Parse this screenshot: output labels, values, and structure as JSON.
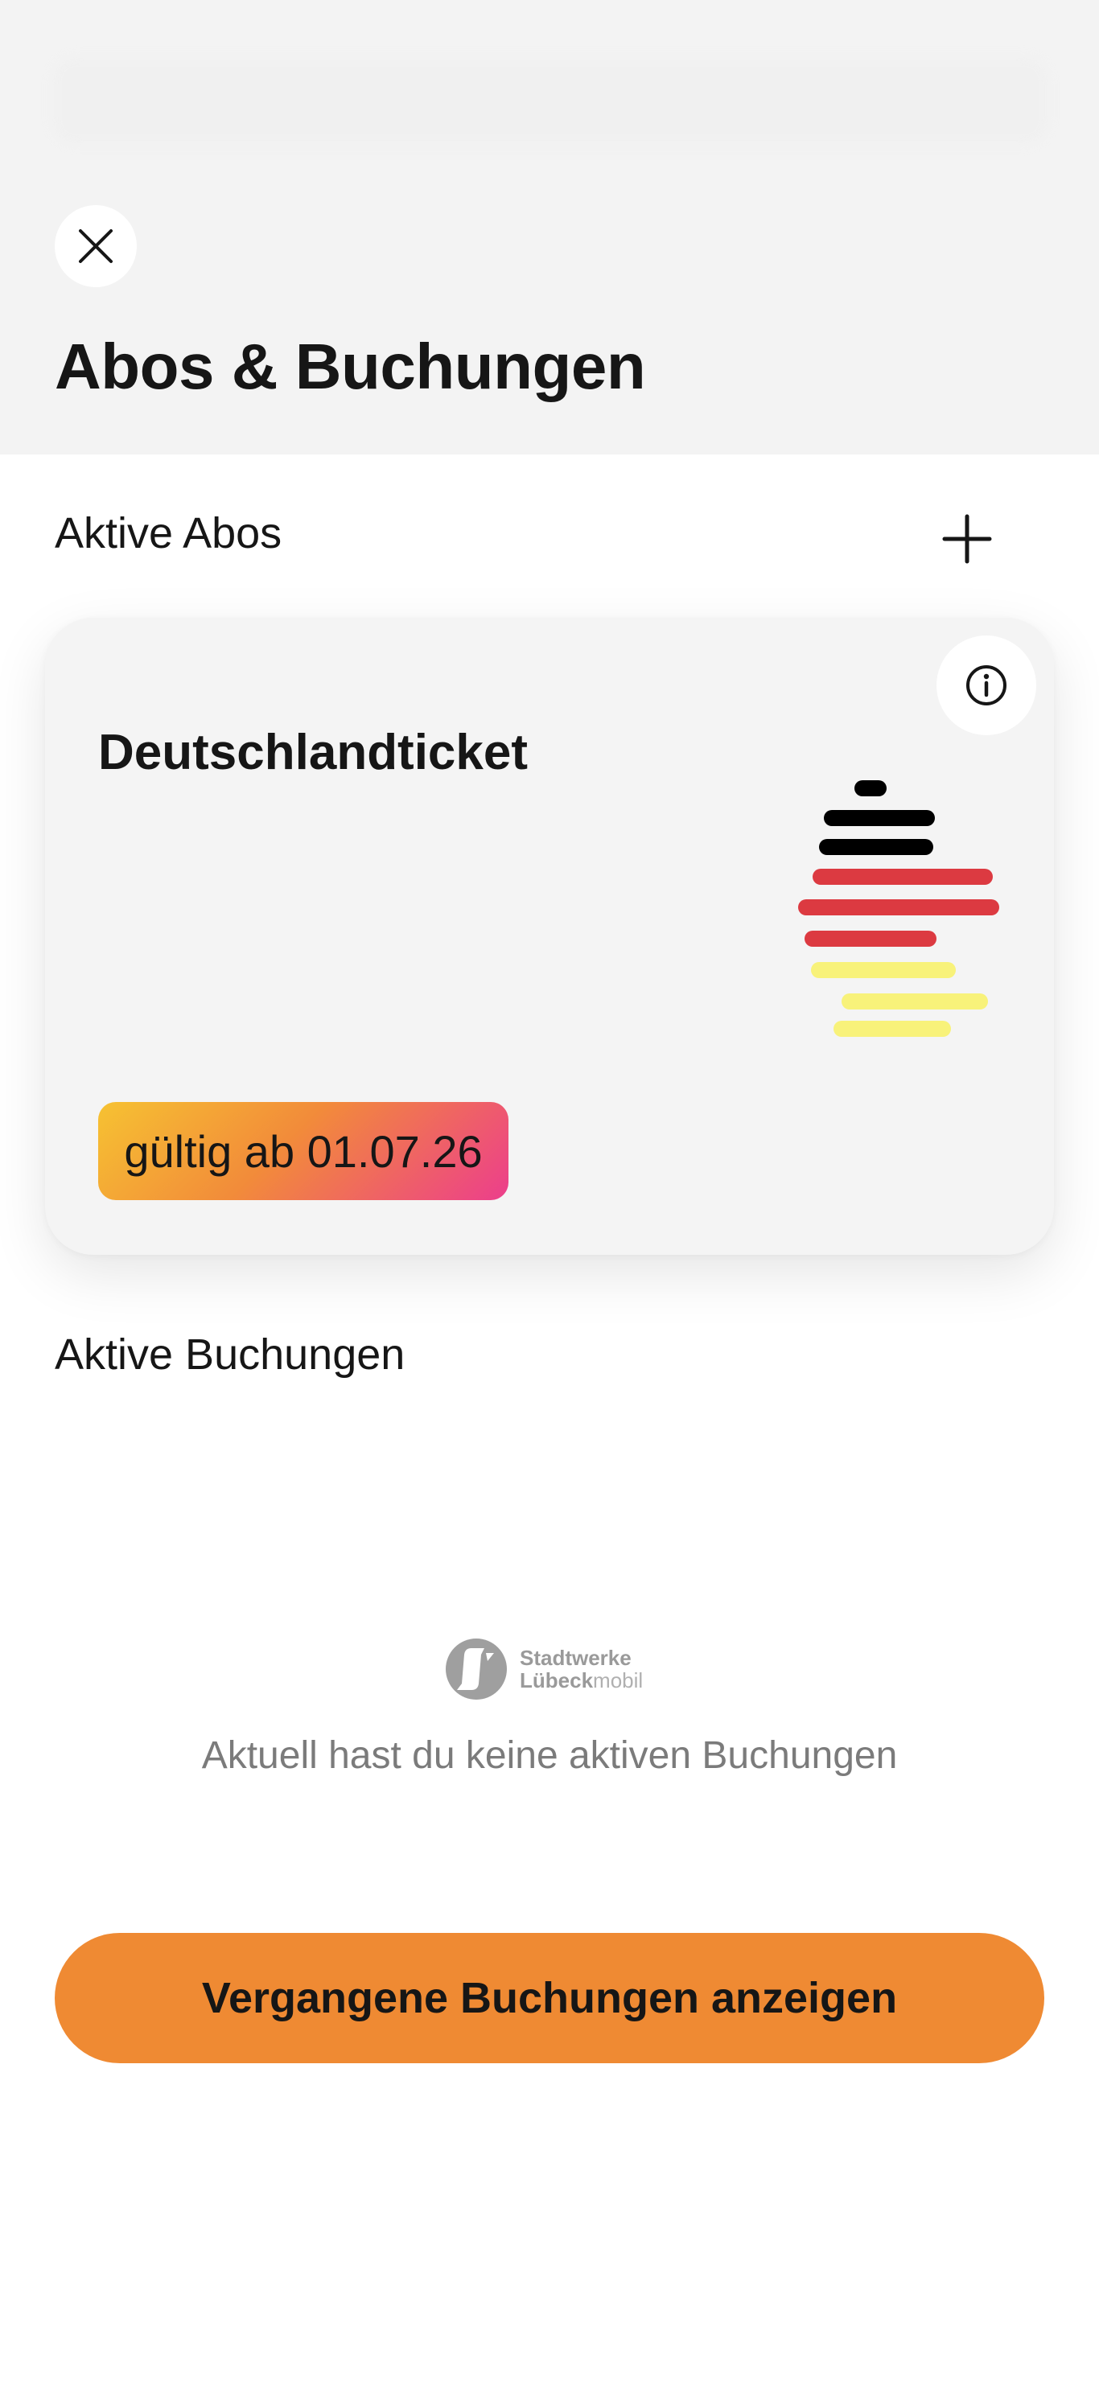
{
  "header": {
    "title": "Abos & Buchungen",
    "close_icon": "close-icon"
  },
  "subscriptions": {
    "section_title": "Aktive Abos",
    "add_icon": "plus-icon",
    "card": {
      "name": "Deutschlandticket",
      "validity": "gültig ab 01.07.26",
      "info_icon": "info-icon",
      "logo": "deutschlandticket-logo",
      "logo_colors": [
        "#000000",
        "#dc3a41",
        "#f8f27a"
      ],
      "badge_gradient": [
        "#f6c232",
        "#f28b3a",
        "#ec3e8c"
      ]
    }
  },
  "bookings": {
    "section_title": "Aktive Buchungen",
    "brand_logo": {
      "line1": "Stadtwerke",
      "line2_bold": "Lübeck",
      "line2_light": "mobil"
    },
    "empty_message": "Aktuell hast du keine aktiven Buchungen"
  },
  "actions": {
    "history_button": "Vergangene Buchungen anzeigen"
  },
  "colors": {
    "accent": "#ef8a33",
    "header_bg": "#f3f3f3",
    "card_bg": "#f4f4f4",
    "text": "#161616",
    "muted_text": "#7b7b7b"
  }
}
